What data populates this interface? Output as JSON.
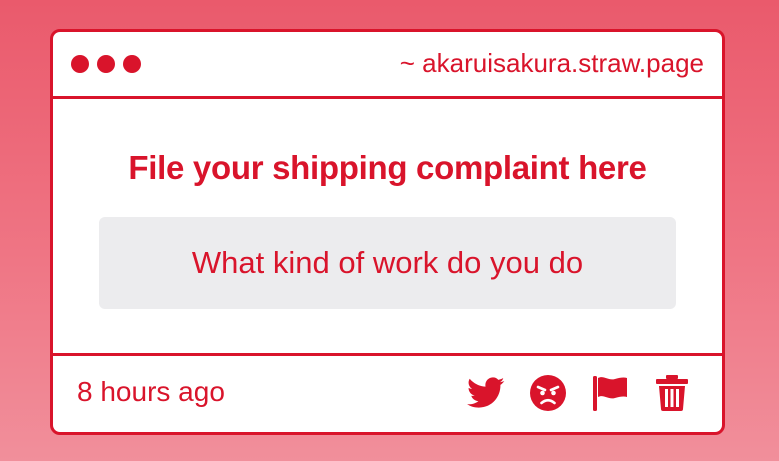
{
  "window": {
    "url": "~ akaruisakura.straw.page"
  },
  "post": {
    "question": "File your shipping complaint here",
    "answer": "What kind of work do you do",
    "time": "8 hours ago"
  },
  "actions": [
    {
      "icon": "twitter-icon"
    },
    {
      "icon": "angry-face-icon"
    },
    {
      "icon": "flag-icon"
    },
    {
      "icon": "trash-icon"
    }
  ],
  "colors": {
    "accent": "#d9142b",
    "answer_bg": "#ececee",
    "background_top": "#ea5a6c",
    "background_bottom": "#f18f9b"
  }
}
